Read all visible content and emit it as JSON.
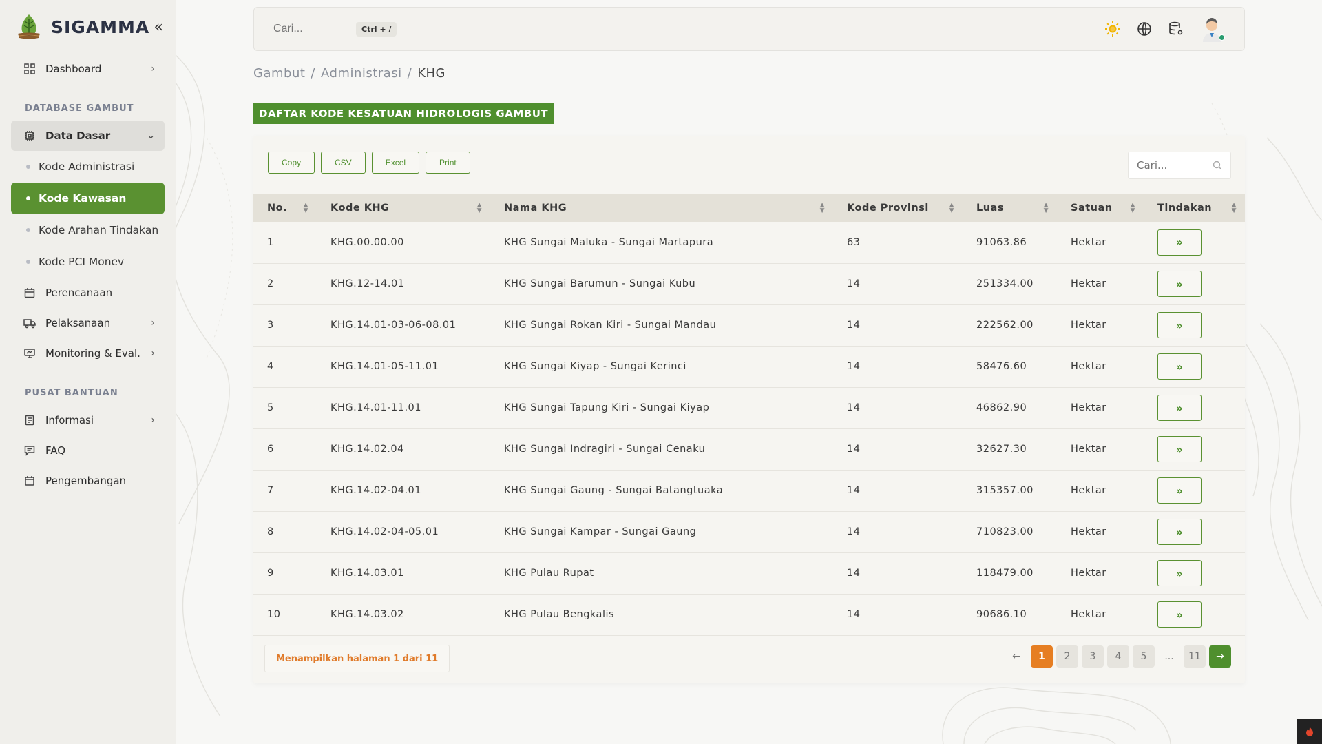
{
  "brand": {
    "name": "SIGAMMA"
  },
  "sidebar": {
    "dashboard": "Dashboard",
    "section_database": "DATABASE GAMBUT",
    "data_dasar": "Data Dasar",
    "sub_items": [
      "Kode Administrasi",
      "Kode Kawasan",
      "Kode Arahan Tindakan",
      "Kode PCI Monev"
    ],
    "perencanaan": "Perencanaan",
    "pelaksanaan": "Pelaksanaan",
    "monitoring": "Monitoring & Eval.",
    "section_help": "PUSAT BANTUAN",
    "informasi": "Informasi",
    "faq": "FAQ",
    "pengembangan": "Pengembangan"
  },
  "topbar": {
    "search_placeholder": "Cari...",
    "shortcut": "Ctrl + /"
  },
  "breadcrumb": [
    "Gambut",
    "Administrasi",
    "KHG"
  ],
  "page_title": "DAFTAR KODE KESATUAN HIDROLOGIS GAMBUT",
  "toolbar": {
    "copy": "Copy",
    "csv": "CSV",
    "excel": "Excel",
    "print": "Print"
  },
  "table_search_placeholder": "Cari...",
  "table": {
    "headers": [
      "No.",
      "Kode KHG",
      "Nama KHG",
      "Kode Provinsi",
      "Luas",
      "Satuan",
      "Tindakan"
    ],
    "rows": [
      [
        "1",
        "KHG.00.00.00",
        "KHG Sungai Maluka - Sungai Martapura",
        "63",
        "91063.86",
        "Hektar"
      ],
      [
        "2",
        "KHG.12-14.01",
        "KHG Sungai Barumun - Sungai Kubu",
        "14",
        "251334.00",
        "Hektar"
      ],
      [
        "3",
        "KHG.14.01-03-06-08.01",
        "KHG Sungai Rokan Kiri - Sungai Mandau",
        "14",
        "222562.00",
        "Hektar"
      ],
      [
        "4",
        "KHG.14.01-05-11.01",
        "KHG Sungai Kiyap - Sungai Kerinci",
        "14",
        "58476.60",
        "Hektar"
      ],
      [
        "5",
        "KHG.14.01-11.01",
        "KHG Sungai Tapung Kiri - Sungai Kiyap",
        "14",
        "46862.90",
        "Hektar"
      ],
      [
        "6",
        "KHG.14.02.04",
        "KHG Sungai Indragiri - Sungai Cenaku",
        "14",
        "32627.30",
        "Hektar"
      ],
      [
        "7",
        "KHG.14.02-04.01",
        "KHG Sungai Gaung - Sungai Batangtuaka",
        "14",
        "315357.00",
        "Hektar"
      ],
      [
        "8",
        "KHG.14.02-04-05.01",
        "KHG Sungai Kampar - Sungai Gaung",
        "14",
        "710823.00",
        "Hektar"
      ],
      [
        "9",
        "KHG.14.03.01",
        "KHG Pulau Rupat",
        "14",
        "118479.00",
        "Hektar"
      ],
      [
        "10",
        "KHG.14.03.02",
        "KHG Pulau Bengkalis",
        "14",
        "90686.10",
        "Hektar"
      ]
    ],
    "action_label": "»"
  },
  "footer": {
    "info": "Menampilkan halaman 1 dari 11",
    "pages": [
      "1",
      "2",
      "3",
      "4",
      "5",
      "...",
      "11"
    ],
    "prev": "←",
    "next": "→"
  },
  "colors": {
    "primary_green": "#4f8f2e",
    "accent_orange": "#e67e22"
  }
}
